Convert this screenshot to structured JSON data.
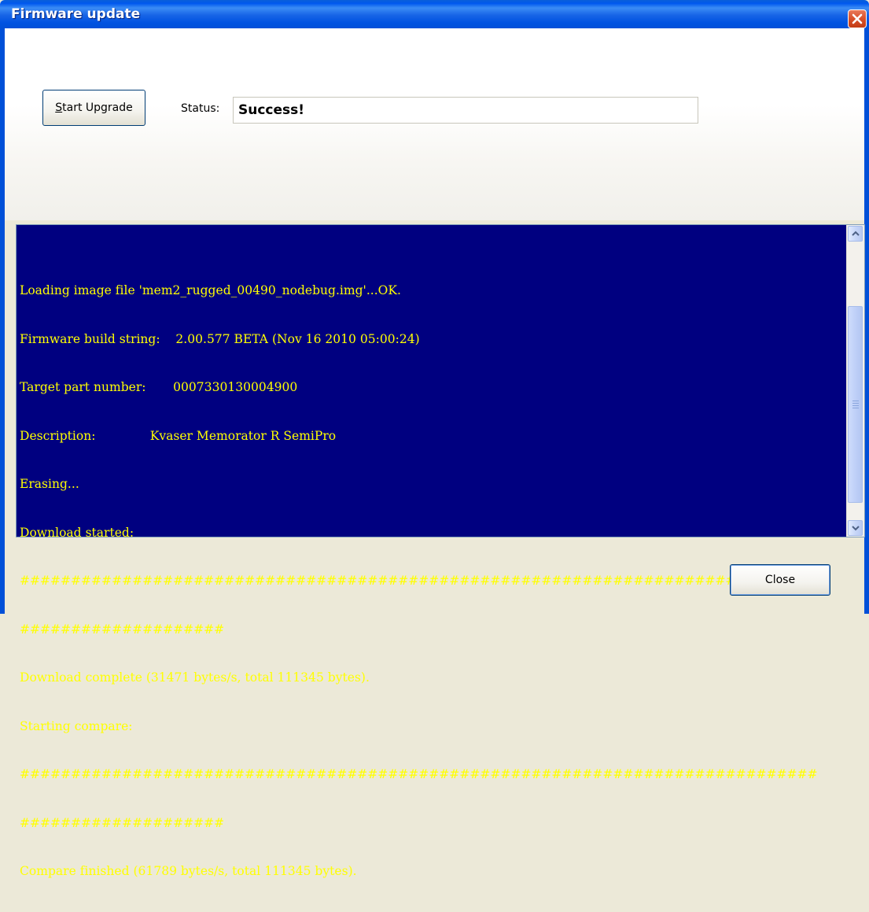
{
  "window": {
    "title": "Firmware update"
  },
  "controls": {
    "start_button_label": "Start Upgrade",
    "start_button_mnemonic": "S",
    "start_button_rest": "tart Upgrade",
    "status_label": "Status:",
    "status_value": "Success!",
    "close_button_label": "Close"
  },
  "log": {
    "lines": [
      "Loading image file 'mem2_rugged_00490_nodebug.img'...OK.",
      "Firmware build string:    2.00.577 BETA (Nov 16 2010 05:00:24)",
      "Target part number:       0007330130004900",
      "Description:              Kvaser Memorator R SemiPro",
      "Erasing...",
      "Download started:",
      "##############################################################################",
      "####################",
      "Download complete (31471 bytes/s, total 111345 bytes).",
      "Starting compare:",
      "##############################################################################",
      "####################",
      "Compare finished (61789 bytes/s, total 111345 bytes)."
    ]
  },
  "colors": {
    "log_background": "#000080",
    "log_text": "#ffff00",
    "title_bar": "#0050d8"
  }
}
